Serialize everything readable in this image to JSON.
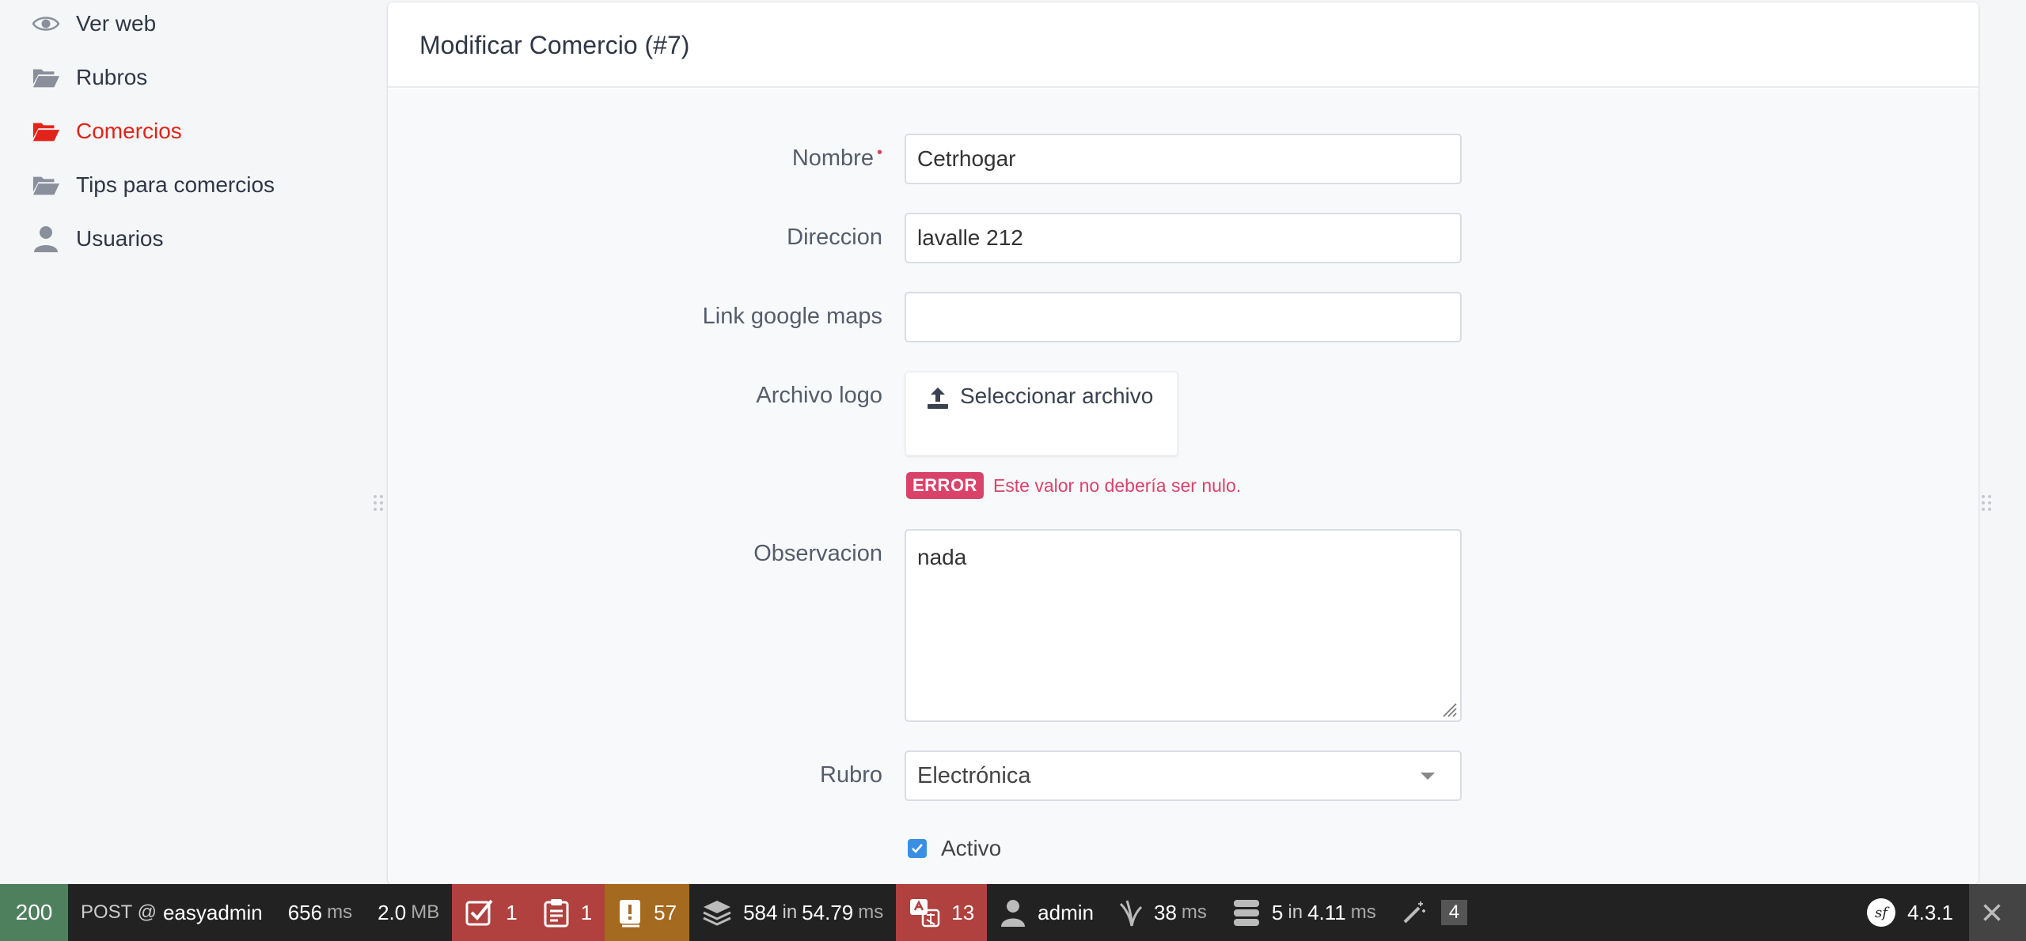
{
  "sidebar": {
    "items": [
      {
        "label": "Ver web",
        "icon": "eye-icon"
      },
      {
        "label": "Rubros",
        "icon": "folder-open-icon"
      },
      {
        "label": "Comercios",
        "icon": "folder-open-icon",
        "active": true
      },
      {
        "label": "Tips para comercios",
        "icon": "folder-open-icon"
      },
      {
        "label": "Usuarios",
        "icon": "user-icon"
      }
    ]
  },
  "form": {
    "title": "Modificar Comercio (#7)",
    "required_marker": "•",
    "fields": {
      "nombre": {
        "label": "Nombre",
        "value": "Cetrhogar"
      },
      "direccion": {
        "label": "Direccion",
        "value": "lavalle 212"
      },
      "link": {
        "label": "Link google maps",
        "value": ""
      },
      "logo": {
        "label": "Archivo logo",
        "button": "Seleccionar archivo"
      },
      "observacion": {
        "label": "Observacion",
        "value": "nada"
      },
      "rubro": {
        "label": "Rubro",
        "selected": "Electrónica"
      },
      "activo": {
        "label": "Activo",
        "checked": true
      }
    },
    "error": {
      "badge": "ERROR",
      "message": "Este valor no debería ser nulo."
    }
  },
  "toolbar": {
    "status": "200",
    "method": "POST @",
    "route": "easyadmin",
    "time": "656",
    "time_unit": "ms",
    "memory": "2.0",
    "memory_unit": "MB",
    "forms": "1",
    "validator": "1",
    "logs": "57",
    "twig": "584",
    "twig_in": "in",
    "twig_time": "54.79",
    "twig_unit": "ms",
    "translation": "13",
    "user": "admin",
    "events_time": "38",
    "events_unit": "ms",
    "db_queries": "5",
    "db_in": "in",
    "db_time": "4.11",
    "db_unit": "ms",
    "magic": "4",
    "version": "4.3.1"
  },
  "colors": {
    "accent_active": "#e2231a",
    "error": "#d9436a",
    "checkbox": "#3b8fe3",
    "status_ok": "#4f805d",
    "toolbar_red": "#b0413e",
    "toolbar_amber": "#a46a1f"
  }
}
